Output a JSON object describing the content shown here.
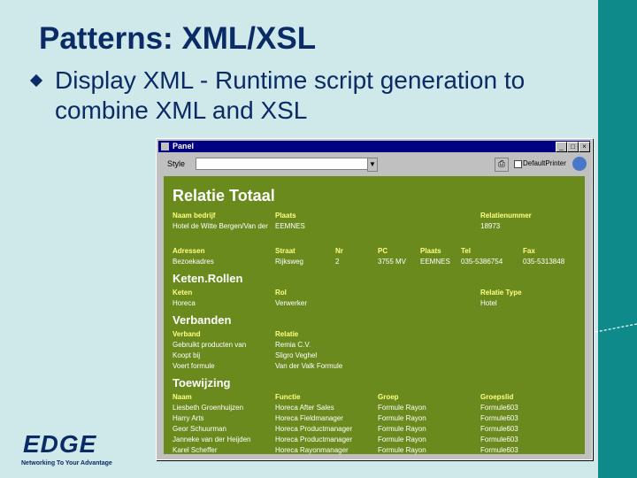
{
  "slide": {
    "title": "Patterns: XML/XSL",
    "bullet": "Display XML - Runtime script generation to combine XML and XSL",
    "logo": {
      "word": "EDGE",
      "tagline": "Networking To Your Advantage"
    }
  },
  "window": {
    "title": "Panel",
    "buttons": {
      "minimize": "_",
      "maximize": "□",
      "close": "×"
    },
    "toolbar": {
      "style_label": "Style",
      "style_value": "",
      "default_printer_label": "DefaultPrinter"
    }
  },
  "report": {
    "title": "Relatie Totaal",
    "company": {
      "headers": [
        "Naam bedrijf",
        "Plaats",
        "Relatienummer"
      ],
      "values": [
        "Hotel de Witte Bergen/Van der",
        "EEMNES",
        "18973"
      ]
    },
    "address": {
      "headers": [
        "Adressen",
        "Straat",
        "Nr",
        "PC",
        "Plaats",
        "Tel",
        "Fax"
      ],
      "values": [
        "Bezoekadres",
        "Rijksweg",
        "2",
        "3755 MV",
        "EEMNES",
        "035-5386754",
        "035-5313848"
      ]
    },
    "keten": {
      "heading": "Keten.Rollen",
      "headers": [
        "Keten",
        "Rol",
        "Relatie Type"
      ],
      "values": [
        "Horeca",
        "Verwerker",
        "Hotel"
      ]
    },
    "verbanden": {
      "heading": "Verbanden",
      "headers": [
        "Verband",
        "Relatie"
      ],
      "rows": [
        [
          "Gebruikt producten van",
          "Remia C.V."
        ],
        [
          "Koopt bij",
          "Sligro Veghel"
        ],
        [
          "Voert formule",
          "Van der Valk Formule"
        ]
      ]
    },
    "toewijzing": {
      "heading": "Toewijzing",
      "headers": [
        "Naam",
        "Functie",
        "Groep",
        "Groepslid"
      ],
      "rows": [
        [
          "Liesbeth Groenhuijzen",
          "Horeca After Sales",
          "Formule Rayon",
          "Formule603"
        ],
        [
          "Harry Arts",
          "Horeca Fieldmanager",
          "Formule Rayon",
          "Formule603"
        ],
        [
          "Geor Schuurman",
          "Horeca Productmanager",
          "Formule Rayon",
          "Formule603"
        ],
        [
          "Janneke van der Heijden",
          "Horeca Productmanager",
          "Formule Rayon",
          "Formule603"
        ],
        [
          "Karel Scheffer",
          "Horeca Rayonmanager",
          "Formule Rayon",
          "Formule603"
        ]
      ]
    }
  },
  "colors": {
    "background": "#cfe9ea",
    "band": "#0f8a8a",
    "title_text": "#0b2b66",
    "report_bg": "#6b8a1e",
    "report_label": "#ffff80"
  }
}
